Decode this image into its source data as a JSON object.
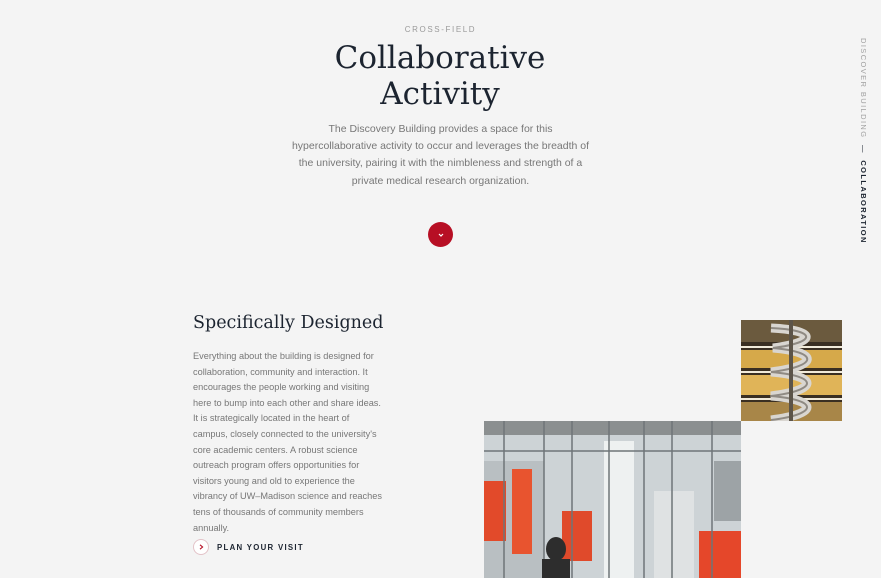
{
  "hero": {
    "eyebrow": "CROSS-FIELD",
    "title_line1": "Collaborative",
    "title_line2": "Activity",
    "body": "The Discovery Building provides a space for this hypercollaborative activity to occur and leverages the breadth of the university, pairing it with the nimbleness and strength of a private medical research organization."
  },
  "side_nav": {
    "parent": "DISCOVER BUILDING",
    "separator": "—",
    "current": "COLLABORATION"
  },
  "section": {
    "title": "Specifically Designed",
    "body": "Everything about the building is designed for collaboration, community and interaction. It encourages the people working and visiting here to bump into each other and share ideas. It is strategically located in the heart of campus, closely connected to the university's core academic centers. A robust science outreach program offers opportunities for visitors young and old to experience the vibrancy of UW–Madison science and reaches tens of thousands of community members annually.",
    "cta_label": "PLAN YOUR VISIT"
  },
  "icons": {
    "scroll": "chevron-down-icon",
    "cta": "chevron-right-icon"
  },
  "colors": {
    "accent": "#b70f24",
    "background": "#f4f4f4",
    "heading": "#1c2430",
    "body_text": "#777777"
  }
}
